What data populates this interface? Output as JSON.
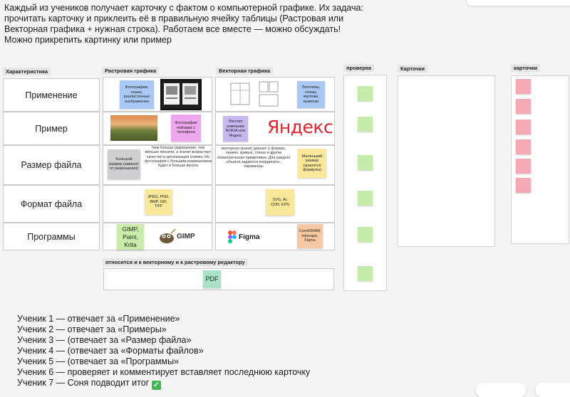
{
  "intro": {
    "line1": "Каждый из учеников получает карточку с фактом о компьютерной графике. Их задача:",
    "line2": "прочитать карточку и приклеить её в правильную ячейку таблицы (Растровая или",
    "line3": "Векторная графика + нужная строка). Работаем все вместе — можно обсуждать!",
    "line4": "Можно прикрепить картинку или пример"
  },
  "table": {
    "headers": {
      "characteristic": "Характеристика",
      "raster": "Растровая графика",
      "vector": "Векторная графика"
    },
    "rows": [
      "Применение",
      "Пример",
      "Размер файла",
      "Формат файла",
      "Программы"
    ]
  },
  "stickies": {
    "raster_use": "Фотографии, сканы, реалистичные изображения",
    "vector_use": "Логотипы, схемы, чертежи, вывески",
    "raster_example": "Фотография пейзажа с телефона",
    "vector_example": "Логотип компании NOKIA или Яндекс",
    "yandex_logo": "Яндекс",
    "raster_size_sticky": "Большой размер (зависит от разрешения)",
    "raster_size_text": "Чем больше разрешение, тем меньше пиксели, а значит возрастает качество и детализация снимка. Но фотография с большим разрешением будет и больше весить",
    "vector_size_text": "векторная хранит данные о формах, линиях, кривых, точках и других геометрических примитивах. Для каждого объекта задаются координаты, параметры",
    "vector_size_sticky": "Маленький размер (хранятся формулы)",
    "raster_format": "JPEG, PNG, BMP, GIF, TIFF",
    "vector_format": "SVG, AI, CDR, EPS",
    "raster_programs": "GIMP, Paint, Krita",
    "gimp_logo": "GIMP",
    "figma_logo": "Figma",
    "vector_programs": "CorelDRAW, Inkscape, Figma"
  },
  "both_section": {
    "header": "относится и к векторному и к растровому редактору",
    "pdf": "PDF"
  },
  "panels": {
    "check": "проверка",
    "cards_main": "Карточки",
    "cards_side": "карточки"
  },
  "students": [
    "Ученик 1 — отвечает за «Применение»",
    "Ученик 2 —  отвечает за «Примеры»",
    "Ученик 3 —  (отвечает за «Размер файла»",
    "Ученик 4 —  (отвечает за «Форматы файлов»",
    "Ученик 5 —  (отвечает за «Программы»",
    "Ученик 6 —  проверяет и комментирует вставляет последнюю карточку",
    "Ученик 7 — Соня подводит итог"
  ],
  "colors": {
    "green_sticky": "#c6ecab",
    "pink_sticky": "#f4aab5",
    "check_green": "#3fb950"
  },
  "icons": {
    "check": "white-check-mark-icon"
  }
}
